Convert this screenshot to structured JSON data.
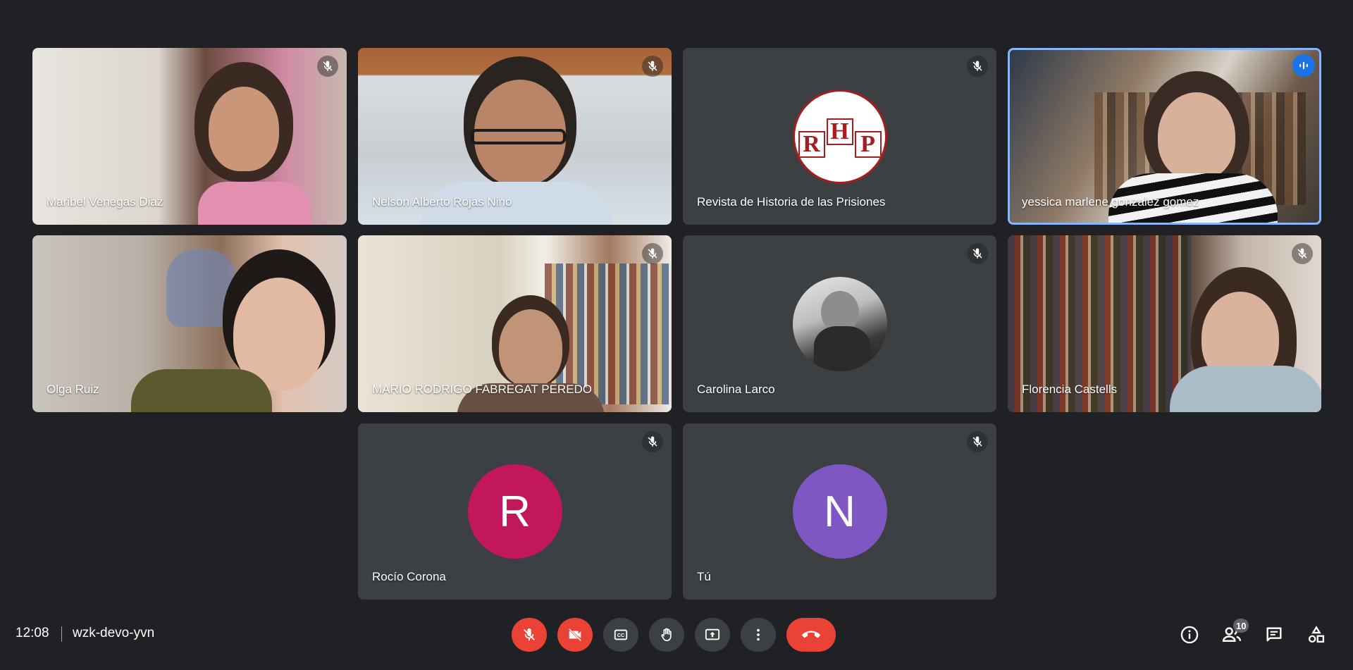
{
  "participants": [
    {
      "name": "Maribel Venegas Diaz",
      "muted": true
    },
    {
      "name": "Nelson Alberto Rojas Nino",
      "muted": true
    },
    {
      "name": "Revista de Historia de las Prisiones",
      "muted": true,
      "logo_text": "RHP"
    },
    {
      "name": "yessica marlene gonzalez gomez",
      "speaking": true
    },
    {
      "name": "Olga Ruiz",
      "muted": false
    },
    {
      "name": "MARIO RODRIGO FABREGAT PEREDO",
      "muted": true
    },
    {
      "name": "Carolina Larco",
      "muted": true
    },
    {
      "name": "Florencia Castells",
      "muted": true
    },
    {
      "name": "Rocío Corona",
      "muted": true,
      "initial": "R",
      "avatar_color": "#c2185b"
    },
    {
      "name": "Tú",
      "muted": true,
      "initial": "N",
      "avatar_color": "#7e57c2"
    }
  ],
  "footer": {
    "time": "12:08",
    "meeting_code": "wzk-devo-yvn",
    "people_count": "10"
  },
  "colors": {
    "background": "#202124",
    "tile": "#3c4043",
    "danger": "#ea4335",
    "active_border": "#8ab4f8"
  },
  "icons": {
    "controls": [
      "mic-off-icon",
      "videocam-off-icon",
      "closed-caption-icon",
      "raise-hand-icon",
      "present-icon",
      "more-vert-icon",
      "call-end-icon"
    ],
    "side": [
      "info-icon",
      "people-icon",
      "chat-icon",
      "activities-icon"
    ]
  }
}
